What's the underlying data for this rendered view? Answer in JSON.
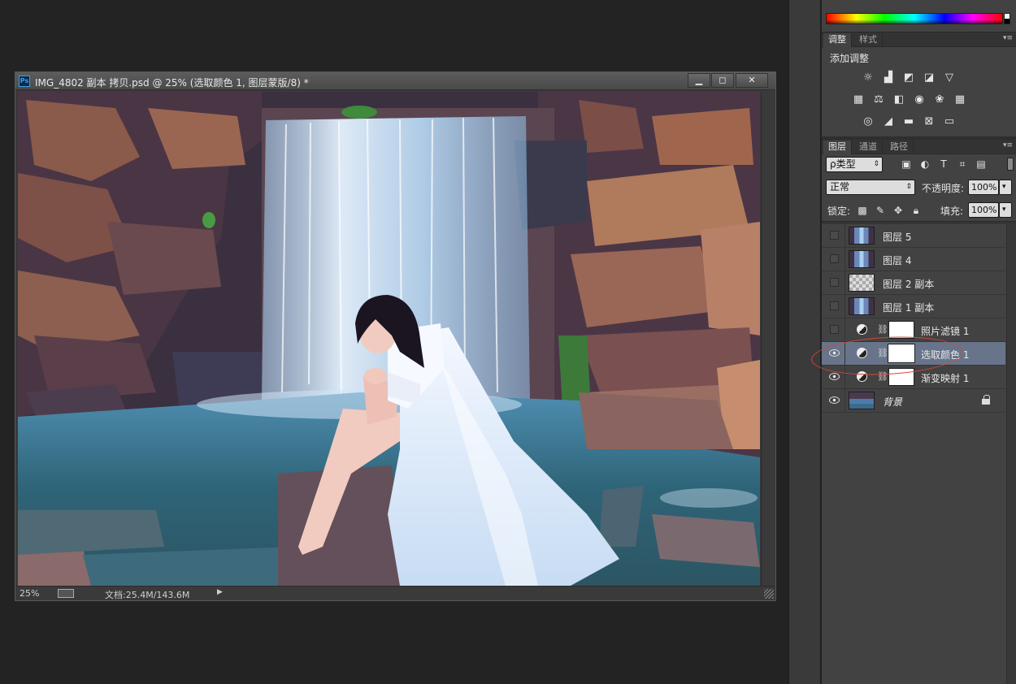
{
  "document": {
    "title": "IMG_4802 副本 拷贝.psd @ 25% (选取颜色 1, 图层蒙版/8) *",
    "app_icon_label": "Ps",
    "min_label": "▁",
    "max_label": "◻",
    "close_label": "✕",
    "zoom": "25%",
    "doc_info": "文档:25.4M/143.6M",
    "status_arrow": "▶"
  },
  "adjustments_panel": {
    "tabs": [
      "调整",
      "样式"
    ],
    "title": "添加调整",
    "menu_icon": "▾≡",
    "icons_row_1": [
      "brightness-contrast-icon",
      "levels-icon",
      "curves-icon",
      "exposure-icon",
      "vibrance-icon"
    ],
    "icons_row_2": [
      "hue-saturation-icon",
      "color-balance-icon",
      "black-white-icon",
      "photo-filter-icon",
      "channel-mixer-icon",
      "color-lookup-icon"
    ],
    "icons_row_3": [
      "invert-icon",
      "posterize-icon",
      "threshold-icon",
      "selective-color-icon",
      "gradient-map-icon"
    ]
  },
  "layers_panel": {
    "tabs": [
      "图层",
      "通道",
      "路径"
    ],
    "filter_label": "ρ类型",
    "blend_mode": "正常",
    "opacity_label": "不透明度:",
    "opacity_value": "100%",
    "lock_label": "锁定:",
    "fill_label": "填充:",
    "fill_value": "100%",
    "arrow": "▾",
    "layers": [
      {
        "name": "图层 5",
        "visible": false,
        "type": "image"
      },
      {
        "name": "图层 4",
        "visible": false,
        "type": "image"
      },
      {
        "name": "图层 2 副本",
        "visible": false,
        "type": "transparent"
      },
      {
        "name": "图层 1 副本",
        "visible": false,
        "type": "image"
      },
      {
        "name": "照片滤镜 1",
        "visible": false,
        "type": "adjustment"
      },
      {
        "name": "选取颜色 1",
        "visible": true,
        "type": "adjustment",
        "selected": true
      },
      {
        "name": "渐变映射 1",
        "visible": true,
        "type": "adjustment"
      },
      {
        "name": "背景",
        "visible": true,
        "type": "background",
        "locked": true
      }
    ]
  },
  "colors": {
    "accent_selected": "#67748a",
    "annotation": "#d8453a"
  }
}
